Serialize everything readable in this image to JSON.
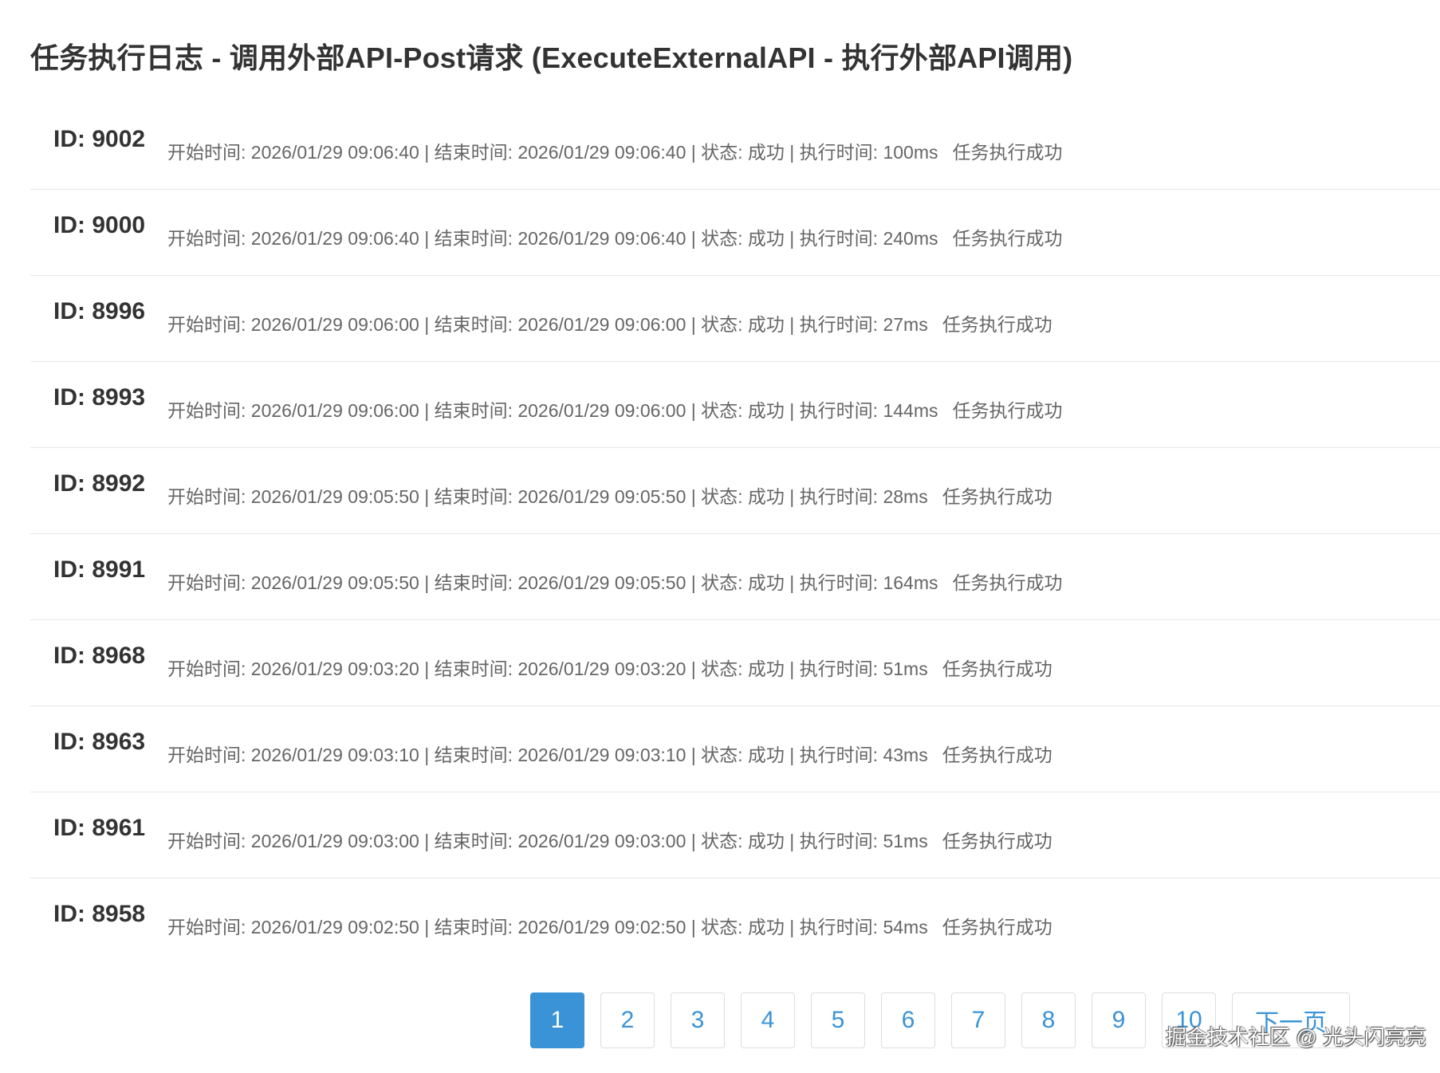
{
  "title": "任务执行日志 - 调用外部API-Post请求 (ExecuteExternalAPI - 执行外部API调用)",
  "logs": [
    {
      "id": "ID: 9002",
      "meta": "开始时间: 2026/01/29 09:06:40 | 结束时间: 2026/01/29 09:06:40 | 状态: 成功 | 执行时间: 100ms",
      "message": "任务执行成功"
    },
    {
      "id": "ID: 9000",
      "meta": "开始时间: 2026/01/29 09:06:40 | 结束时间: 2026/01/29 09:06:40 | 状态: 成功 | 执行时间: 240ms",
      "message": "任务执行成功"
    },
    {
      "id": "ID: 8996",
      "meta": "开始时间: 2026/01/29 09:06:00 | 结束时间: 2026/01/29 09:06:00 | 状态: 成功 | 执行时间: 27ms",
      "message": "任务执行成功"
    },
    {
      "id": "ID: 8993",
      "meta": "开始时间: 2026/01/29 09:06:00 | 结束时间: 2026/01/29 09:06:00 | 状态: 成功 | 执行时间: 144ms",
      "message": "任务执行成功"
    },
    {
      "id": "ID: 8992",
      "meta": "开始时间: 2026/01/29 09:05:50 | 结束时间: 2026/01/29 09:05:50 | 状态: 成功 | 执行时间: 28ms",
      "message": "任务执行成功"
    },
    {
      "id": "ID: 8991",
      "meta": "开始时间: 2026/01/29 09:05:50 | 结束时间: 2026/01/29 09:05:50 | 状态: 成功 | 执行时间: 164ms",
      "message": "任务执行成功"
    },
    {
      "id": "ID: 8968",
      "meta": "开始时间: 2026/01/29 09:03:20 | 结束时间: 2026/01/29 09:03:20 | 状态: 成功 | 执行时间: 51ms",
      "message": "任务执行成功"
    },
    {
      "id": "ID: 8963",
      "meta": "开始时间: 2026/01/29 09:03:10 | 结束时间: 2026/01/29 09:03:10 | 状态: 成功 | 执行时间: 43ms",
      "message": "任务执行成功"
    },
    {
      "id": "ID: 8961",
      "meta": "开始时间: 2026/01/29 09:03:00 | 结束时间: 2026/01/29 09:03:00 | 状态: 成功 | 执行时间: 51ms",
      "message": "任务执行成功"
    },
    {
      "id": "ID: 8958",
      "meta": "开始时间: 2026/01/29 09:02:50 | 结束时间: 2026/01/29 09:02:50 | 状态: 成功 | 执行时间: 54ms",
      "message": "任务执行成功"
    }
  ],
  "pagination": {
    "pages": [
      "1",
      "2",
      "3",
      "4",
      "5",
      "6",
      "7",
      "8",
      "9",
      "10"
    ],
    "current": "1",
    "next_label": "下一页"
  },
  "watermark": "掘金技术社区 @ 光头闪亮亮",
  "colors": {
    "accent": "#3a93d6",
    "text": "#333333",
    "muted": "#666666",
    "divider": "#e6e6e6"
  }
}
